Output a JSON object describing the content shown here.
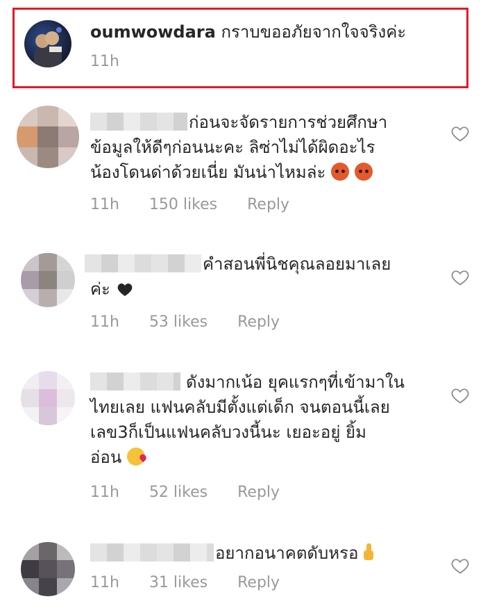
{
  "comments": [
    {
      "username": "oumwowdara",
      "text": "กราบขออภัยจากใจจริงค่ะ",
      "time": "11h",
      "avatar_icon": "user-photo-icon"
    },
    {
      "line1": "ก่อนจะจัดรายการช่วยศึกษา",
      "line2": "ข้อมูลให้ดีๆก่อนนะคะ ลิซ่าไม่ได้ผิดอะไร",
      "line3": "น้องโดนด่าด้วยเนี่ย มันน่าไหมล่ะ",
      "emoji": "angry-face-icon",
      "time": "11h",
      "likes": "150 likes",
      "reply": "Reply"
    },
    {
      "line1": "คำสอนพี่นิชคุณลอยมาเลย",
      "line2": "ค่ะ",
      "emoji": "heart-icon",
      "time": "11h",
      "likes": "53 likes",
      "reply": "Reply"
    },
    {
      "line1": "ดังมากเน้อ ยุคแรกๆที่เข้ามาใน",
      "line2": "ไทยเลย แฟนคลับมีตั้งแต่เด็ก จนตอนนี้เลย",
      "line3": "เลข3ก็เป็นแฟนคลับวงนี้นะ เยอะอยู่ ยิ้ม",
      "line4": "อ่อน",
      "emoji": "kissing-face-icon",
      "time": "11h",
      "likes": "52 likes",
      "reply": "Reply"
    },
    {
      "line1": "อยากอนาคตดับหรอ",
      "emoji": "middle-finger-icon",
      "time": "11h",
      "likes": "31 likes",
      "reply": "Reply"
    }
  ],
  "colors": {
    "highlight": "#e01b24",
    "meta": "#999999",
    "text": "#262626"
  }
}
